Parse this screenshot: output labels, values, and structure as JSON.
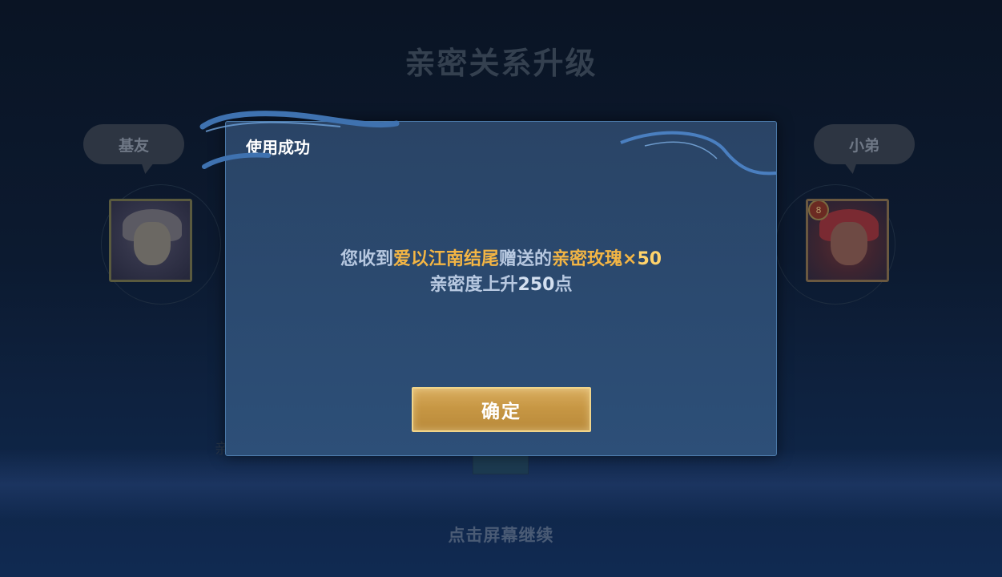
{
  "background": {
    "title": "亲密关系升级",
    "left_relation": "基友",
    "right_relation": "小弟",
    "right_level": "8",
    "left_partial_text": "亲",
    "tap_to_continue": "点击屏幕继续"
  },
  "dialog": {
    "title": "使用成功",
    "message": {
      "prefix": "您收到",
      "sender": "爱以江南结尾",
      "middle": "赠送的",
      "item": "亲密玫瑰",
      "times": "×",
      "quantity": "50",
      "line2_prefix": "亲密度上升",
      "line2_value": "250",
      "line2_suffix": "点"
    },
    "confirm_label": "确定"
  },
  "colors": {
    "highlight": "#f3b544",
    "dialog_bg": "#2b4a70",
    "button_gold": "#c79744"
  }
}
